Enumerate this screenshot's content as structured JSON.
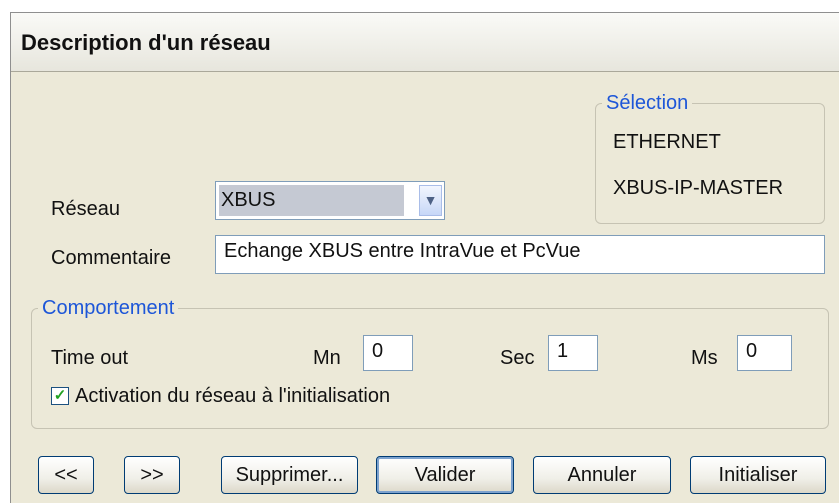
{
  "dialog": {
    "title": "Description d'un réseau"
  },
  "selection": {
    "legend": "Sélection",
    "line1": "ETHERNET",
    "line2": "XBUS-IP-MASTER"
  },
  "network": {
    "label": "Réseau",
    "value": "XBUS"
  },
  "comment": {
    "label": "Commentaire",
    "value": "Echange XBUS entre IntraVue et PcVue"
  },
  "behavior": {
    "legend": "Comportement",
    "timeout_label": "Time out",
    "mn_label": "Mn",
    "mn_value": "0",
    "sec_label": "Sec",
    "sec_value": "1",
    "ms_label": "Ms",
    "ms_value": "0",
    "activation_label": "Activation du réseau à l'initialisation",
    "activation_checked": true
  },
  "buttons": {
    "prev": "<<",
    "next": ">>",
    "delete": "Supprimer...",
    "validate": "Valider",
    "cancel": "Annuler",
    "init": "Initialiser"
  }
}
